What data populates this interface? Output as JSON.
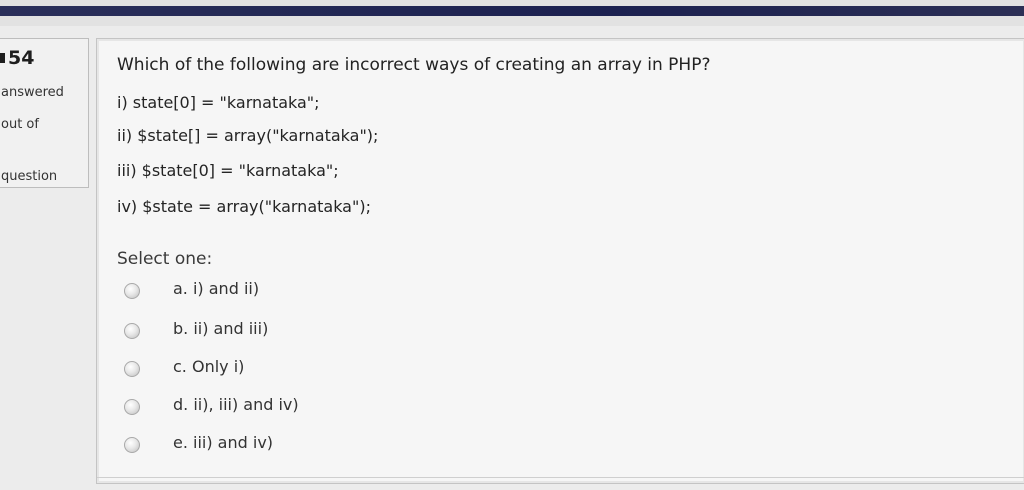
{
  "question_info": {
    "number": "54",
    "status": "answered",
    "marks": "out of",
    "label": "question"
  },
  "question": {
    "text": "Which of the following are incorrect ways of creating an array in PHP?",
    "statements": [
      "i) state[0] = \"karnataka\";",
      "ii) $state[] = array(\"karnataka\");",
      "iii) $state[0] = \"karnataka\";",
      "iv) $state = array(\"karnataka\");"
    ]
  },
  "answer": {
    "prompt": "Select one:",
    "options": [
      {
        "text": "a. i) and ii)"
      },
      {
        "text": "b. ii) and iii)"
      },
      {
        "text": "c. Only i)"
      },
      {
        "text": "d. ii), iii) and iv)"
      },
      {
        "text": "e. iii) and iv)"
      }
    ]
  }
}
